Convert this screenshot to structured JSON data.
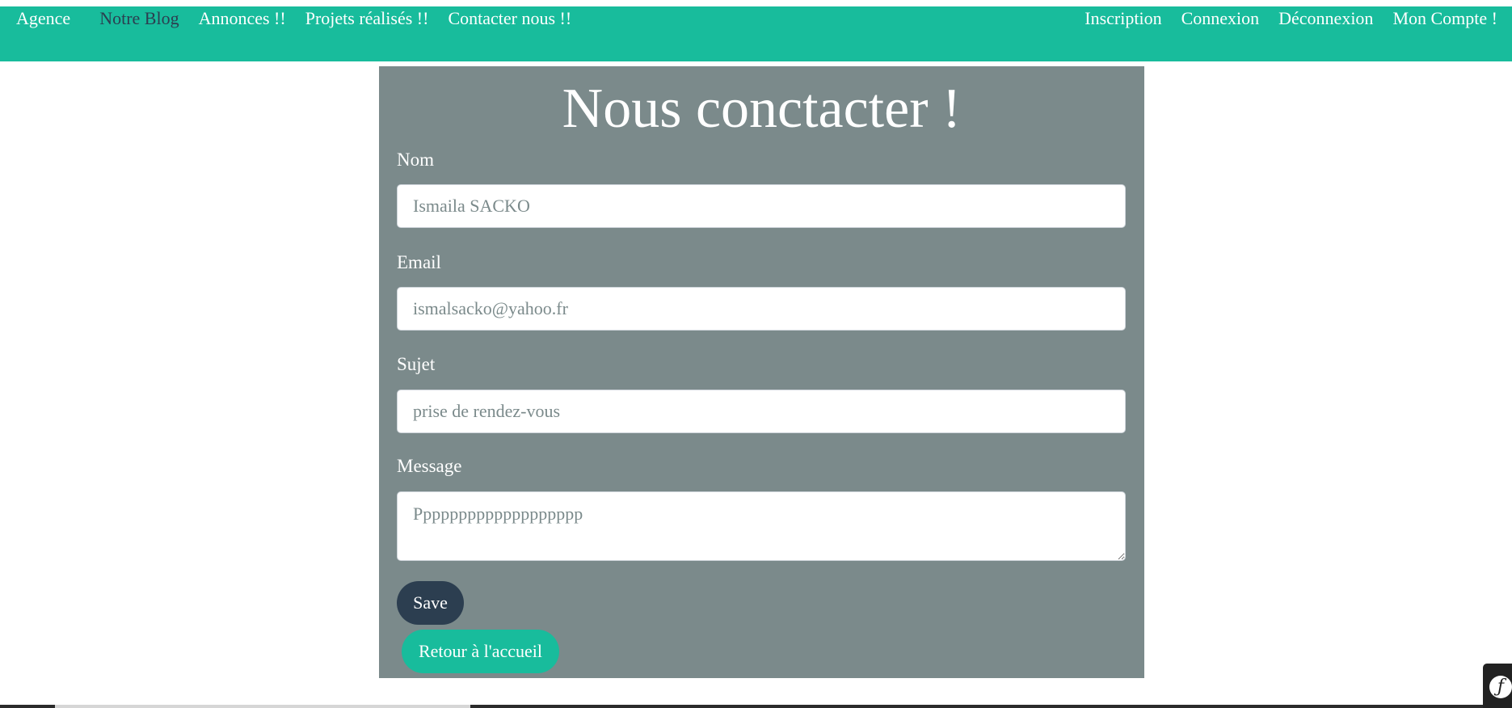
{
  "nav": {
    "left": [
      "Agence",
      "Notre Blog",
      "Annonces !!",
      "Projets réalisés !!",
      "Contacter nous !!"
    ],
    "right": [
      "Inscription",
      "Connexion",
      "Déconnexion",
      "Mon Compte !"
    ]
  },
  "form": {
    "title": "Nous conctacter !",
    "nom": {
      "label": "Nom",
      "value": "Ismaila SACKO"
    },
    "email": {
      "label": "Email",
      "value": "ismalsacko@yahoo.fr"
    },
    "sujet": {
      "label": "Sujet",
      "value": "prise de rendez-vous"
    },
    "message": {
      "label": "Message",
      "value": "Ppppppppppppppppppp"
    },
    "save_label": "Save",
    "back_label": "Retour à l'accueil"
  },
  "toolbar": {
    "icon": "symfony-logo-icon"
  },
  "colors": {
    "brand": "#18bc9c",
    "panel": "#7b8a8b",
    "dark": "#2c3e50"
  }
}
